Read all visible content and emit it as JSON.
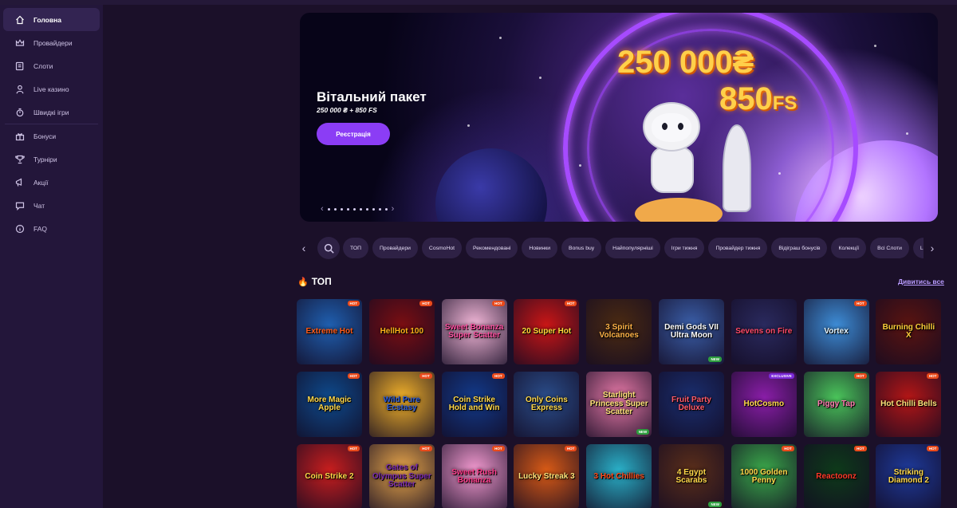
{
  "sidebar": {
    "items": [
      {
        "label": "Головна",
        "icon": "home-icon",
        "active": true
      },
      {
        "label": "Провайдери",
        "icon": "crown-icon"
      },
      {
        "label": "Слоти",
        "icon": "slot-machine-icon"
      },
      {
        "label": "Live казино",
        "icon": "dealer-icon"
      },
      {
        "label": "Швидкі ігри",
        "icon": "stopwatch-icon"
      },
      {
        "label": "Бонуси",
        "icon": "gift-icon"
      },
      {
        "label": "Турніри",
        "icon": "trophy-icon"
      },
      {
        "label": "Акції",
        "icon": "megaphone-icon"
      },
      {
        "label": "Чат",
        "icon": "chat-icon"
      },
      {
        "label": "FAQ",
        "icon": "info-icon"
      }
    ]
  },
  "banner": {
    "title": "Вітальний пакет",
    "subtitle": "250 000 ₴ + 850 FS",
    "button": "Реєстрація",
    "amount": "250 000₴",
    "fs": "850",
    "fs_suffix": "FS",
    "slides": 10
  },
  "filters": [
    "ТОП",
    "Провайдери",
    "CosmoHot",
    "Рекомендовані",
    "Новинки",
    "Bonus buy",
    "Найпопулярніші",
    "Ігри тижня",
    "Провайдер тижня",
    "Відіграш бонусів",
    "Колекції",
    "Всі Слоти",
    "Le W"
  ],
  "section": {
    "title": "ТОП",
    "see_all": "Дивитись все"
  },
  "games": [
    {
      "name": "Extreme Hot",
      "bg": "#1f5fb0",
      "fg": "#ff5a1a",
      "badge": "HOT"
    },
    {
      "name": "HellHot 100",
      "bg": "#7a0e12",
      "fg": "#ffb21a",
      "badge": "HOT"
    },
    {
      "name": "Sweet Bonanza Super Scatter",
      "bg": "#f3b7d8",
      "fg": "#ff4fa2",
      "badge": "HOT"
    },
    {
      "name": "20 Super Hot",
      "bg": "#c91616",
      "fg": "#ffd83a",
      "badge": "HOT"
    },
    {
      "name": "3 Spirit Volcanoes",
      "bg": "#4a2a12",
      "fg": "#ffb347",
      "badge": ""
    },
    {
      "name": "Demi Gods VII Ultra Moon",
      "bg": "#3a5ea8",
      "fg": "#ffffff",
      "badge": "NEW"
    },
    {
      "name": "Sevens on Fire",
      "bg": "#2a2a5e",
      "fg": "#ff4a6a",
      "badge": ""
    },
    {
      "name": "Vortex",
      "bg": "#3d8cd6",
      "fg": "#e6f6ff",
      "badge": "HOT"
    },
    {
      "name": "Burning Chilli X",
      "bg": "#5a1410",
      "fg": "#ffcf3a",
      "badge": ""
    },
    {
      "name": "More Magic Apple",
      "bg": "#0e4a8c",
      "fg": "#ffd84a",
      "badge": "HOT"
    },
    {
      "name": "Wild Pure Ecstasy",
      "bg": "#f0b02a",
      "fg": "#2a5ad8",
      "badge": "HOT"
    },
    {
      "name": "Coin Strike Hold and Win",
      "bg": "#123a8a",
      "fg": "#ffd84a",
      "badge": "HOT"
    },
    {
      "name": "Only Coins Express",
      "bg": "#2a4d8a",
      "fg": "#ffd84a",
      "badge": ""
    },
    {
      "name": "Starlight Princess Super Scatter",
      "bg": "#e87aa8",
      "fg": "#ffe27a",
      "badge": "NEW"
    },
    {
      "name": "Fruit Party Deluxe",
      "bg": "#1a2e6e",
      "fg": "#ff5a6a",
      "badge": ""
    },
    {
      "name": "HotCosmo",
      "bg": "#8a1ea8",
      "fg": "#ffd84a",
      "badge": "EXCLUSIVE"
    },
    {
      "name": "Piggy Tap",
      "bg": "#4ac45a",
      "fg": "#ff7ab0",
      "badge": "HOT"
    },
    {
      "name": "Hot Chilli Bells",
      "bg": "#b31616",
      "fg": "#ffe27a",
      "badge": "HOT"
    },
    {
      "name": "Coin Strike 2",
      "bg": "#c81e1e",
      "fg": "#ffd84a",
      "badge": "HOT"
    },
    {
      "name": "Gates of Olympus Super Scatter",
      "bg": "#e8a64a",
      "fg": "#7a2ab0",
      "badge": "HOT"
    },
    {
      "name": "Sweet Rush Bonanza",
      "bg": "#f39ad0",
      "fg": "#ff3a8a",
      "badge": "HOT"
    },
    {
      "name": "Lucky Streak 3",
      "bg": "#d85a16",
      "fg": "#ffe27a",
      "badge": "HOT"
    },
    {
      "name": "3 Hot Chillies",
      "bg": "#2ab0c8",
      "fg": "#ff4a1a",
      "badge": ""
    },
    {
      "name": "4 Egypt Scarabs",
      "bg": "#5a2e1a",
      "fg": "#ffd84a",
      "badge": "NEW"
    },
    {
      "name": "1000 Golden Penny",
      "bg": "#3aa84a",
      "fg": "#ffd84a",
      "badge": "HOT"
    },
    {
      "name": "Reactoonz",
      "bg": "#0e3a1a",
      "fg": "#ff3a2a",
      "badge": "HOT"
    },
    {
      "name": "Striking Diamond 2",
      "bg": "#1e3a9a",
      "fg": "#ffd84a",
      "badge": "HOT"
    }
  ]
}
